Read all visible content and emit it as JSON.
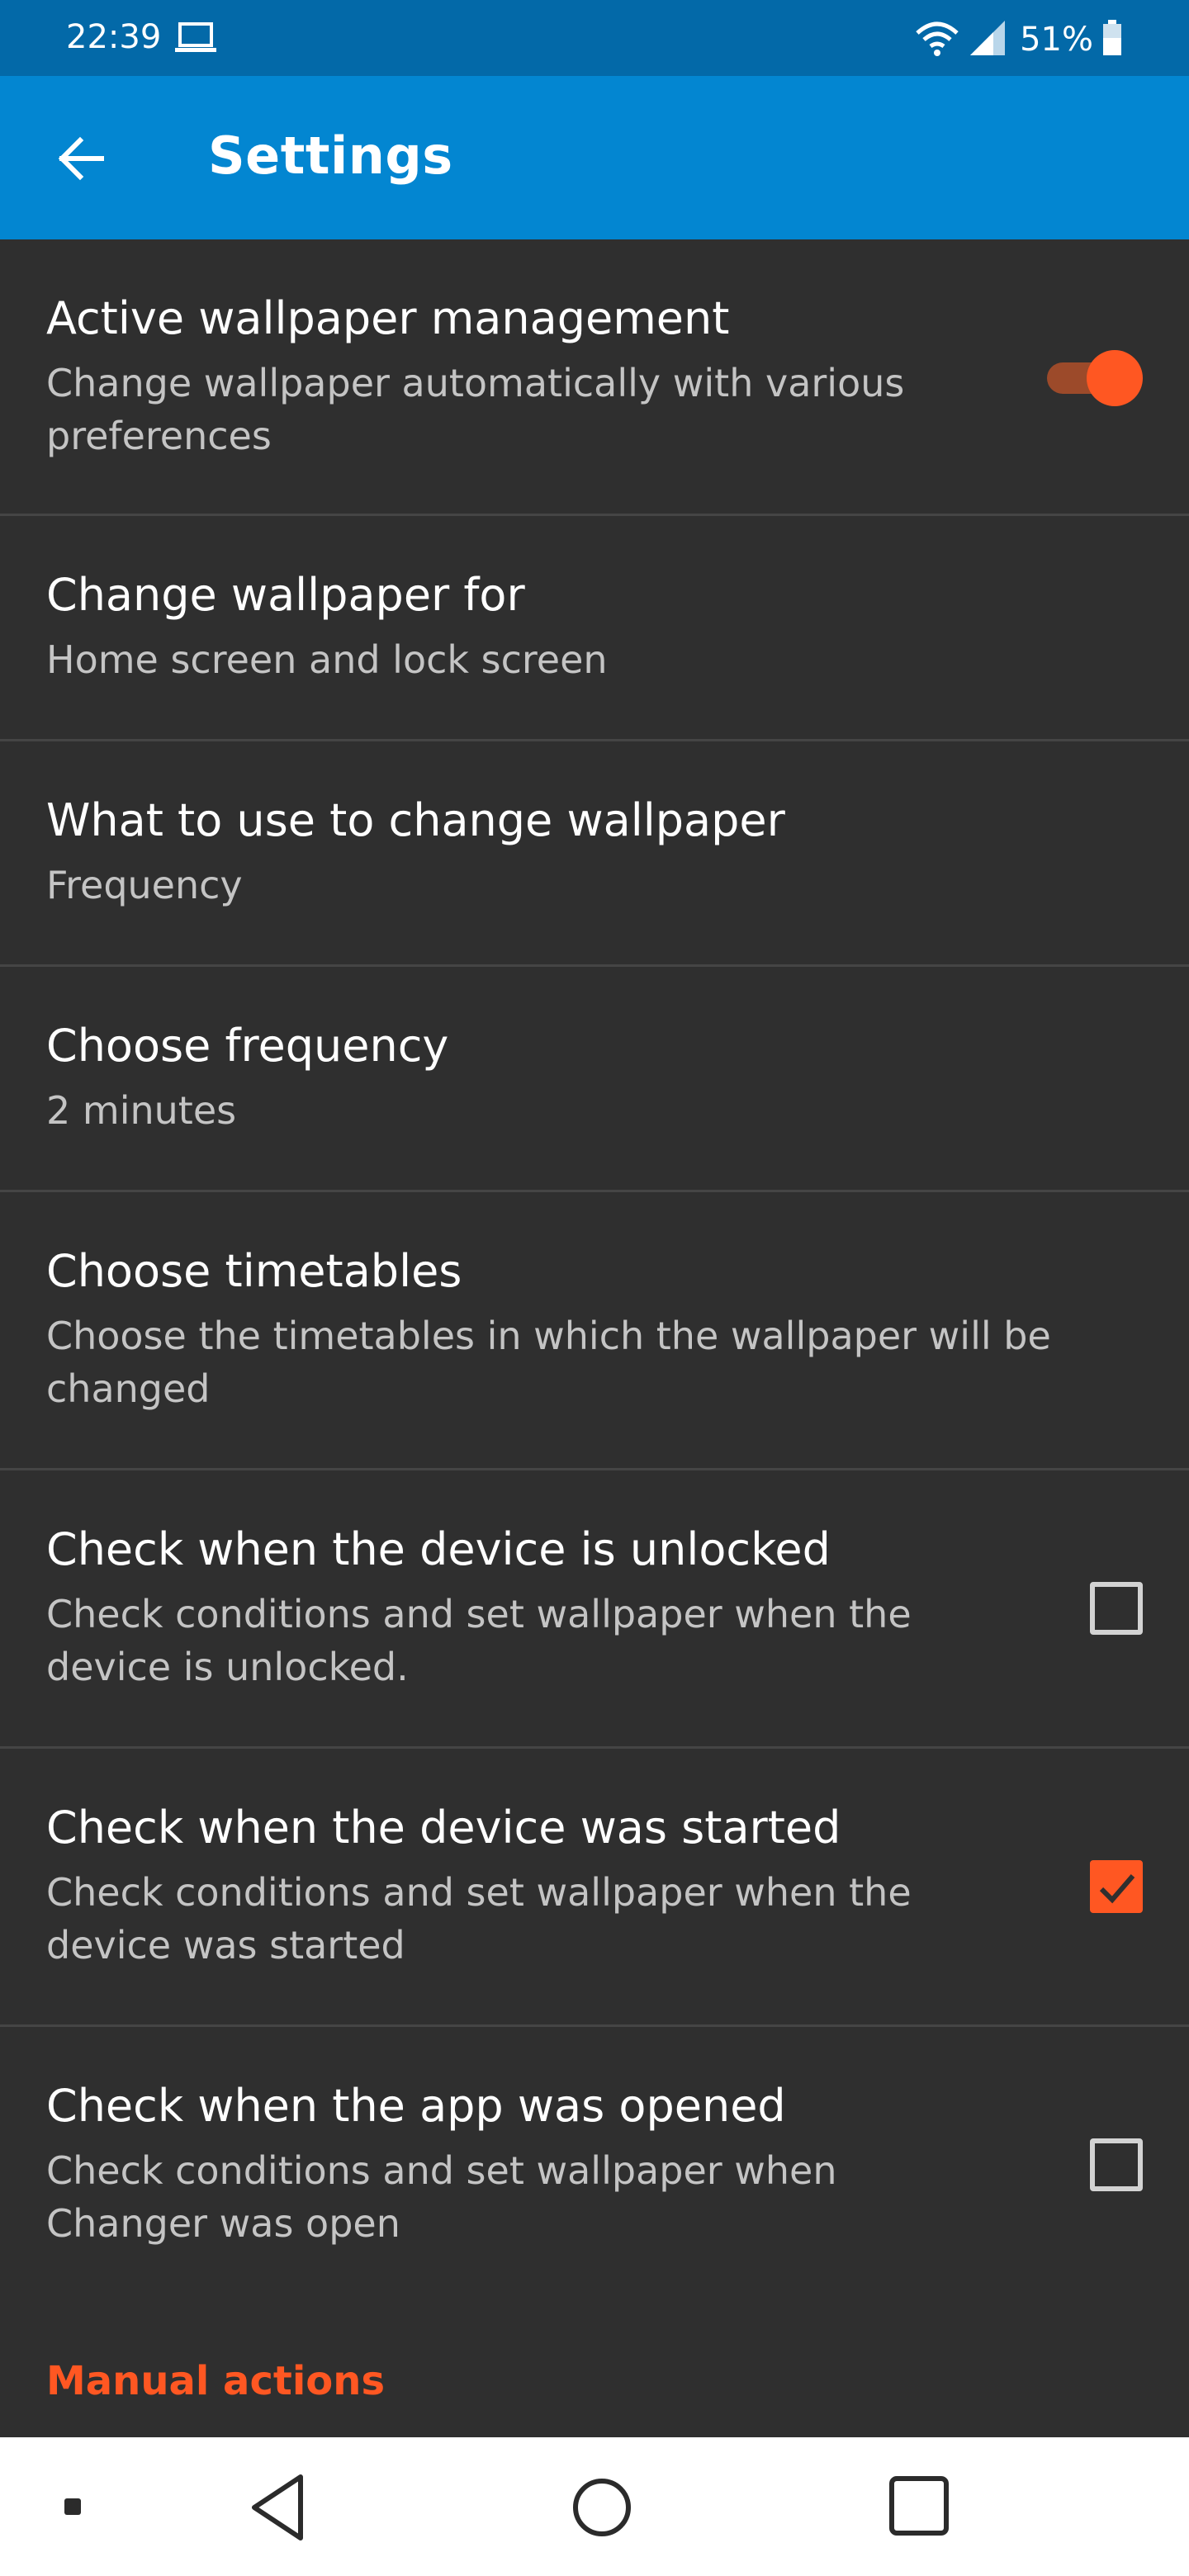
{
  "status_bar": {
    "time": "22:39",
    "battery_percent": "51%",
    "icons": [
      "laptop-icon",
      "wifi-icon",
      "signal-icon",
      "battery-icon"
    ]
  },
  "app_bar": {
    "title": "Settings",
    "back_icon": "arrow-left-icon",
    "color": "#0386d1"
  },
  "settings": [
    {
      "title": "Active wallpaper management",
      "summary": "Change wallpaper automatically with various preferences",
      "control": "toggle",
      "checked": true
    },
    {
      "title": "Change wallpaper for",
      "summary": "Home screen and lock screen"
    },
    {
      "title": "What to use to change wallpaper",
      "summary": "Frequency"
    },
    {
      "title": "Choose frequency",
      "summary": "2 minutes"
    },
    {
      "title": "Choose timetables",
      "summary": "Choose the timetables in which the wallpaper will be changed"
    },
    {
      "title": "Check when the device is unlocked",
      "summary": "Check conditions and set wallpaper when the device is unlocked.",
      "control": "checkbox",
      "checked": false
    },
    {
      "title": "Check when the device was started",
      "summary": "Check conditions and set wallpaper when the device was started",
      "control": "checkbox",
      "checked": true
    },
    {
      "title": "Check when the app was opened",
      "summary": "Check conditions and set wallpaper when Changer was open",
      "control": "checkbox",
      "checked": false
    }
  ],
  "section_header": "Manual actions",
  "accent_color": "#ff5722",
  "nav_bar": {
    "icons": [
      "dot-icon",
      "back-triangle-icon",
      "home-circle-icon",
      "recents-square-icon"
    ]
  }
}
